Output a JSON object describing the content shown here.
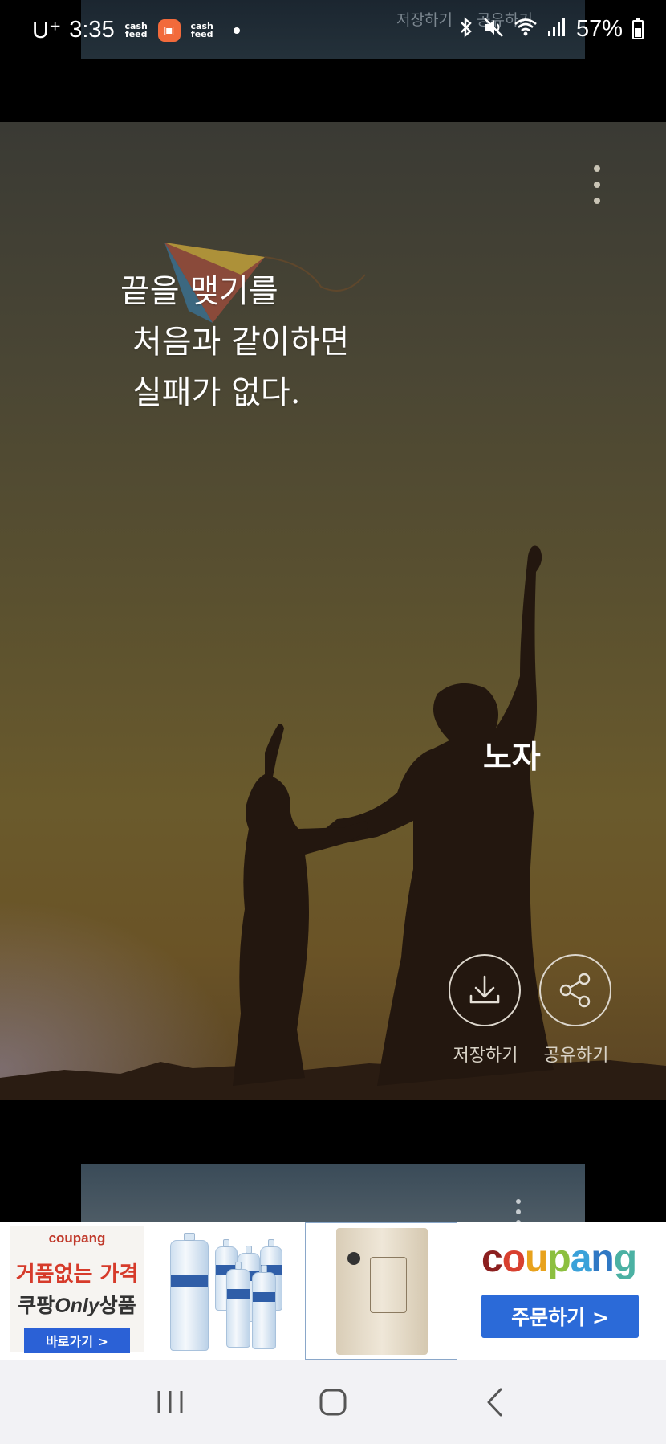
{
  "status_bar": {
    "carrier": "U⁺",
    "time": "3:35",
    "app_badge_1": "cash feed",
    "app_badge_2": "cash feed",
    "battery": "57%",
    "icons": [
      "bluetooth-icon",
      "mute-icon",
      "wifi-icon",
      "signal-icon",
      "battery-icon"
    ]
  },
  "previous_card": {
    "save_label": "저장하기",
    "share_label": "공유하기"
  },
  "quote_card": {
    "quote_lines": [
      "끝을 맺기를",
      "처음과 같이하면",
      "실패가 없다."
    ],
    "author": "노자",
    "save_label": "저장하기",
    "share_label": "공유하기",
    "more_icon": "more-vertical-icon"
  },
  "ad_banner": {
    "ad1": {
      "brand": "coupang",
      "line1": "거품없는 가격",
      "line2_prefix": "쿠팡",
      "line2_emph": "Only",
      "line2_suffix": "상품",
      "button": "바로가기 >"
    },
    "ad4": {
      "brand_letters": [
        {
          "ch": "c",
          "color": "#8b1f1f"
        },
        {
          "ch": "o",
          "color": "#d8402f"
        },
        {
          "ch": "u",
          "color": "#e8a21c"
        },
        {
          "ch": "p",
          "color": "#8cbf3f"
        },
        {
          "ch": "a",
          "color": "#3aa1d9"
        },
        {
          "ch": "n",
          "color": "#2f78c4"
        },
        {
          "ch": "g",
          "color": "#4bb1a3"
        }
      ],
      "button": "주문하기 >"
    }
  },
  "navigation_bar": {
    "buttons": [
      "recent-apps",
      "home",
      "back"
    ]
  }
}
